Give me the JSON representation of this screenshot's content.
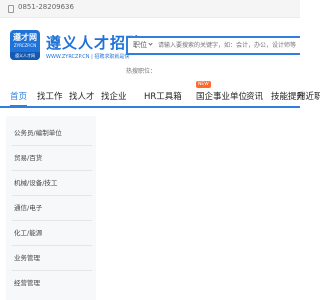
{
  "topbar": {
    "phone": "0851-28209636",
    "phone_icon": "phone-icon"
  },
  "logo": {
    "badge_text": "遵才网",
    "badge_sub": "ZYRCZP.CN",
    "badge_bottom": "遵义人才网",
    "title": "遵义人才招聘网",
    "subtitle": "WWW.ZYRCZP.CN | 招聘求职就是快"
  },
  "search": {
    "type_label": "职位",
    "placeholder": "请输入要搜索的关键字，如：会计，办公，设计师等"
  },
  "hot_label": "热搜职位：",
  "nav": {
    "items": [
      {
        "label": "首页"
      },
      {
        "label": "找工作"
      },
      {
        "label": "找人才"
      },
      {
        "label": "找企业"
      },
      {
        "label": "HR工具箱"
      },
      {
        "label": "国企事业单位"
      },
      {
        "label": "资讯"
      },
      {
        "label": "技能提升"
      },
      {
        "label": "附近职位"
      }
    ],
    "badge": "NEW"
  },
  "categories": [
    {
      "label": "公务员/编制单位"
    },
    {
      "label": "贸易/百货"
    },
    {
      "label": "机械/设备/技工"
    },
    {
      "label": "通信/电子"
    },
    {
      "label": "化工/能源"
    },
    {
      "label": "业务管理"
    },
    {
      "label": "经营管理"
    }
  ],
  "colors": {
    "brand": "#1f72d8",
    "nav_accent": "#2d7fe0",
    "badge": "#ff6a2a"
  }
}
